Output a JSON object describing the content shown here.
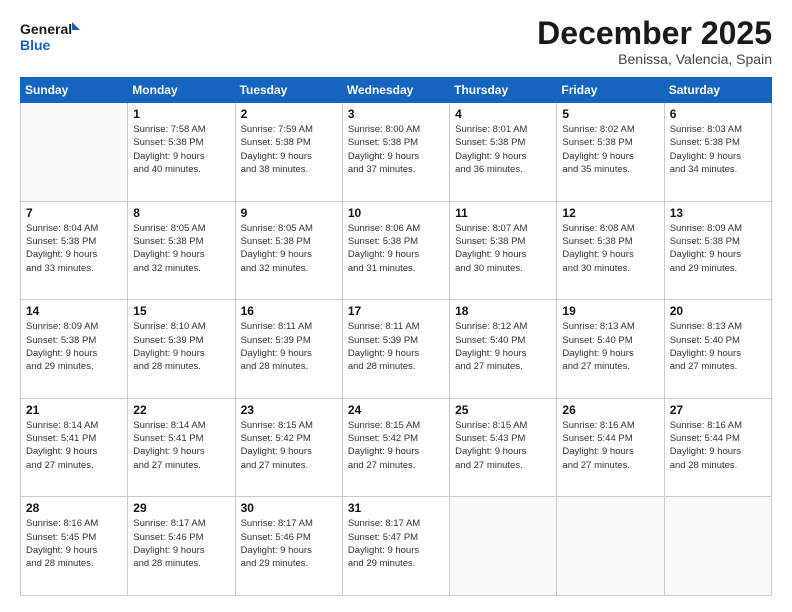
{
  "logo": {
    "line1": "General",
    "line2": "Blue"
  },
  "header": {
    "month": "December 2025",
    "location": "Benissa, Valencia, Spain"
  },
  "weekdays": [
    "Sunday",
    "Monday",
    "Tuesday",
    "Wednesday",
    "Thursday",
    "Friday",
    "Saturday"
  ],
  "weeks": [
    [
      {
        "day": null,
        "info": null
      },
      {
        "day": "1",
        "info": "Sunrise: 7:58 AM\nSunset: 5:38 PM\nDaylight: 9 hours\nand 40 minutes."
      },
      {
        "day": "2",
        "info": "Sunrise: 7:59 AM\nSunset: 5:38 PM\nDaylight: 9 hours\nand 38 minutes."
      },
      {
        "day": "3",
        "info": "Sunrise: 8:00 AM\nSunset: 5:38 PM\nDaylight: 9 hours\nand 37 minutes."
      },
      {
        "day": "4",
        "info": "Sunrise: 8:01 AM\nSunset: 5:38 PM\nDaylight: 9 hours\nand 36 minutes."
      },
      {
        "day": "5",
        "info": "Sunrise: 8:02 AM\nSunset: 5:38 PM\nDaylight: 9 hours\nand 35 minutes."
      },
      {
        "day": "6",
        "info": "Sunrise: 8:03 AM\nSunset: 5:38 PM\nDaylight: 9 hours\nand 34 minutes."
      }
    ],
    [
      {
        "day": "7",
        "info": "Sunrise: 8:04 AM\nSunset: 5:38 PM\nDaylight: 9 hours\nand 33 minutes."
      },
      {
        "day": "8",
        "info": "Sunrise: 8:05 AM\nSunset: 5:38 PM\nDaylight: 9 hours\nand 32 minutes."
      },
      {
        "day": "9",
        "info": "Sunrise: 8:05 AM\nSunset: 5:38 PM\nDaylight: 9 hours\nand 32 minutes."
      },
      {
        "day": "10",
        "info": "Sunrise: 8:06 AM\nSunset: 5:38 PM\nDaylight: 9 hours\nand 31 minutes."
      },
      {
        "day": "11",
        "info": "Sunrise: 8:07 AM\nSunset: 5:38 PM\nDaylight: 9 hours\nand 30 minutes."
      },
      {
        "day": "12",
        "info": "Sunrise: 8:08 AM\nSunset: 5:38 PM\nDaylight: 9 hours\nand 30 minutes."
      },
      {
        "day": "13",
        "info": "Sunrise: 8:09 AM\nSunset: 5:38 PM\nDaylight: 9 hours\nand 29 minutes."
      }
    ],
    [
      {
        "day": "14",
        "info": "Sunrise: 8:09 AM\nSunset: 5:38 PM\nDaylight: 9 hours\nand 29 minutes."
      },
      {
        "day": "15",
        "info": "Sunrise: 8:10 AM\nSunset: 5:39 PM\nDaylight: 9 hours\nand 28 minutes."
      },
      {
        "day": "16",
        "info": "Sunrise: 8:11 AM\nSunset: 5:39 PM\nDaylight: 9 hours\nand 28 minutes."
      },
      {
        "day": "17",
        "info": "Sunrise: 8:11 AM\nSunset: 5:39 PM\nDaylight: 9 hours\nand 28 minutes."
      },
      {
        "day": "18",
        "info": "Sunrise: 8:12 AM\nSunset: 5:40 PM\nDaylight: 9 hours\nand 27 minutes."
      },
      {
        "day": "19",
        "info": "Sunrise: 8:13 AM\nSunset: 5:40 PM\nDaylight: 9 hours\nand 27 minutes."
      },
      {
        "day": "20",
        "info": "Sunrise: 8:13 AM\nSunset: 5:40 PM\nDaylight: 9 hours\nand 27 minutes."
      }
    ],
    [
      {
        "day": "21",
        "info": "Sunrise: 8:14 AM\nSunset: 5:41 PM\nDaylight: 9 hours\nand 27 minutes."
      },
      {
        "day": "22",
        "info": "Sunrise: 8:14 AM\nSunset: 5:41 PM\nDaylight: 9 hours\nand 27 minutes."
      },
      {
        "day": "23",
        "info": "Sunrise: 8:15 AM\nSunset: 5:42 PM\nDaylight: 9 hours\nand 27 minutes."
      },
      {
        "day": "24",
        "info": "Sunrise: 8:15 AM\nSunset: 5:42 PM\nDaylight: 9 hours\nand 27 minutes."
      },
      {
        "day": "25",
        "info": "Sunrise: 8:15 AM\nSunset: 5:43 PM\nDaylight: 9 hours\nand 27 minutes."
      },
      {
        "day": "26",
        "info": "Sunrise: 8:16 AM\nSunset: 5:44 PM\nDaylight: 9 hours\nand 27 minutes."
      },
      {
        "day": "27",
        "info": "Sunrise: 8:16 AM\nSunset: 5:44 PM\nDaylight: 9 hours\nand 28 minutes."
      }
    ],
    [
      {
        "day": "28",
        "info": "Sunrise: 8:16 AM\nSunset: 5:45 PM\nDaylight: 9 hours\nand 28 minutes."
      },
      {
        "day": "29",
        "info": "Sunrise: 8:17 AM\nSunset: 5:46 PM\nDaylight: 9 hours\nand 28 minutes."
      },
      {
        "day": "30",
        "info": "Sunrise: 8:17 AM\nSunset: 5:46 PM\nDaylight: 9 hours\nand 29 minutes."
      },
      {
        "day": "31",
        "info": "Sunrise: 8:17 AM\nSunset: 5:47 PM\nDaylight: 9 hours\nand 29 minutes."
      },
      {
        "day": null,
        "info": null
      },
      {
        "day": null,
        "info": null
      },
      {
        "day": null,
        "info": null
      }
    ]
  ]
}
